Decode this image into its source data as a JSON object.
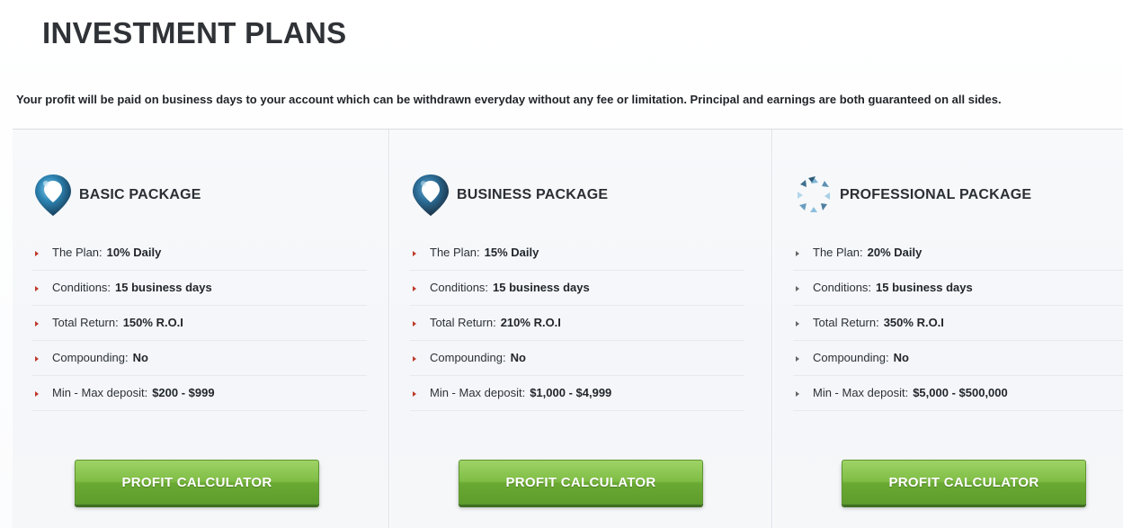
{
  "page": {
    "title": "INVESTMENT PLANS",
    "intro": "Your profit will be paid on business days to your account which can be withdrawn everyday without any fee or limitation. Principal and earnings are both guaranteed on all sides."
  },
  "colors": {
    "button_green": "#7fbd45",
    "bullet_red": "#c0392b",
    "icon_blue": "#2e86b5",
    "icon_dark": "#2f3640"
  },
  "plans": [
    {
      "name": "BASIC PACKAGE",
      "icon": "map-pin-icon",
      "features": [
        {
          "label": "The Plan:",
          "value": "10% Daily"
        },
        {
          "label": "Conditions:",
          "value": "15 business days"
        },
        {
          "label": "Total Return:",
          "value": "150% R.O.I"
        },
        {
          "label": "Compounding:",
          "value": "No"
        },
        {
          "label": "Min - Max deposit:",
          "value": "$200 - $999"
        }
      ],
      "button": "PROFIT CALCULATOR"
    },
    {
      "name": "BUSINESS PACKAGE",
      "icon": "map-pin-icon",
      "features": [
        {
          "label": "The Plan:",
          "value": "15% Daily"
        },
        {
          "label": "Conditions:",
          "value": "15 business days"
        },
        {
          "label": "Total Return:",
          "value": "210% R.O.I"
        },
        {
          "label": "Compounding:",
          "value": "No"
        },
        {
          "label": "Min - Max deposit:",
          "value": "$1,000 - $4,999"
        }
      ],
      "button": "PROFIT CALCULATOR"
    },
    {
      "name": "PROFESSIONAL PACKAGE",
      "icon": "gem-ring-icon",
      "features": [
        {
          "label": "The Plan:",
          "value": "20% Daily"
        },
        {
          "label": "Conditions:",
          "value": "15 business days"
        },
        {
          "label": "Total Return:",
          "value": "350% R.O.I"
        },
        {
          "label": "Compounding:",
          "value": "No"
        },
        {
          "label": "Min - Max deposit:",
          "value": "$5,000 - $500,000"
        }
      ],
      "button": "PROFIT CALCULATOR"
    }
  ]
}
